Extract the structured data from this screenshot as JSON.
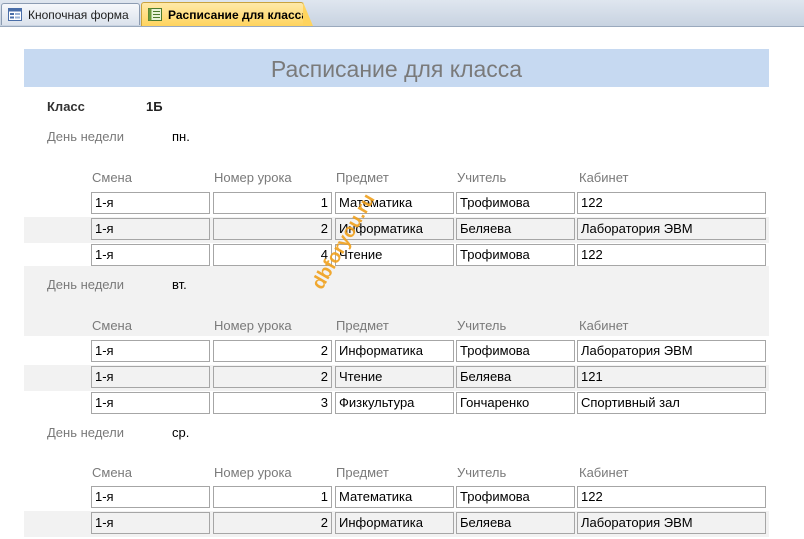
{
  "tabs": [
    {
      "label": "Кнопочная форма",
      "active": false,
      "icon": "form-icon"
    },
    {
      "label": "Расписание для класса",
      "active": true,
      "icon": "report-icon"
    }
  ],
  "report": {
    "title": "Расписание для класса",
    "class_label": "Класс",
    "class_value": "1Б",
    "day_label": "День недели",
    "columns": [
      "Смена",
      "Номер урока",
      "Предмет",
      "Учитель",
      "Кабинет"
    ]
  },
  "days": [
    {
      "day": "пн.",
      "rows": [
        {
          "shift": "1-я",
          "lesson": "1",
          "subject": "Математика",
          "teacher": "Трофимова",
          "room": "122"
        },
        {
          "shift": "1-я",
          "lesson": "2",
          "subject": "Информатика",
          "teacher": "Беляева",
          "room": "Лаборатория ЭВМ"
        },
        {
          "shift": "1-я",
          "lesson": "4",
          "subject": "Чтение",
          "teacher": "Трофимова",
          "room": "122"
        }
      ]
    },
    {
      "day": "вт.",
      "rows": [
        {
          "shift": "1-я",
          "lesson": "2",
          "subject": "Информатика",
          "teacher": "Трофимова",
          "room": "Лаборатория ЭВМ"
        },
        {
          "shift": "1-я",
          "lesson": "2",
          "subject": "Чтение",
          "teacher": "Беляева",
          "room": "121"
        },
        {
          "shift": "1-я",
          "lesson": "3",
          "subject": "Физкультура",
          "teacher": "Гончаренко",
          "room": "Спортивный зал"
        }
      ]
    },
    {
      "day": "ср.",
      "rows": [
        {
          "shift": "1-я",
          "lesson": "1",
          "subject": "Математика",
          "teacher": "Трофимова",
          "room": "122"
        },
        {
          "shift": "1-я",
          "lesson": "2",
          "subject": "Информатика",
          "teacher": "Беляева",
          "room": "Лаборатория ЭВМ"
        }
      ]
    }
  ],
  "watermark": "dbforyou.ru",
  "colors": {
    "title_band": "#c6d9f1",
    "active_tab": "#ffd45e",
    "watermark": "#f0a01c",
    "alt_row": "#f2f2f2"
  }
}
